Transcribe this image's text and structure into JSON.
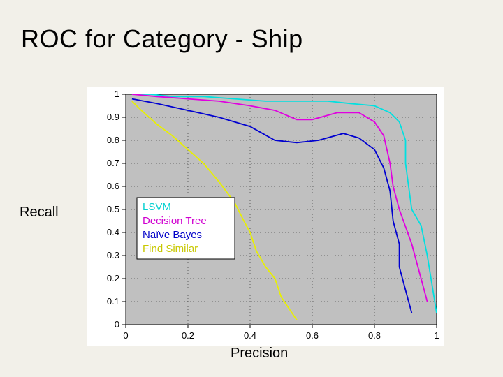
{
  "title": "ROC for Category - Ship",
  "ylabel": "Recall",
  "xlabel": "Precision",
  "legend": {
    "items": [
      "LSVM",
      "Decision Tree",
      "Naïve Bayes",
      "Find Similar"
    ]
  },
  "axes": {
    "x": {
      "min": 0,
      "max": 1,
      "ticks": [
        0,
        0.2,
        0.4,
        0.6,
        0.8,
        1
      ]
    },
    "y": {
      "min": 0,
      "max": 1,
      "ticks": [
        0,
        0.1,
        0.2,
        0.3,
        0.4,
        0.5,
        0.6,
        0.7,
        0.8,
        0.9,
        1
      ]
    }
  },
  "chart_data": {
    "type": "line",
    "title": "ROC for Category - Ship",
    "xlabel": "Precision",
    "ylabel": "Recall",
    "xlim": [
      0,
      1
    ],
    "ylim": [
      0,
      1
    ],
    "grid": true,
    "legend_position": "inside-left",
    "series": [
      {
        "name": "LSVM",
        "color": "#00e0e0",
        "x": [
          0.02,
          0.08,
          0.15,
          0.25,
          0.35,
          0.45,
          0.55,
          0.65,
          0.72,
          0.8,
          0.85,
          0.88,
          0.9,
          0.9,
          0.91,
          0.92,
          0.95,
          0.97,
          1.0
        ],
        "y": [
          1.0,
          1.0,
          0.99,
          0.99,
          0.98,
          0.97,
          0.97,
          0.97,
          0.96,
          0.95,
          0.92,
          0.88,
          0.8,
          0.7,
          0.6,
          0.5,
          0.43,
          0.3,
          0.05
        ]
      },
      {
        "name": "Decision Tree",
        "color": "#e000e0",
        "x": [
          0.02,
          0.1,
          0.2,
          0.3,
          0.4,
          0.48,
          0.55,
          0.6,
          0.68,
          0.75,
          0.8,
          0.83,
          0.85,
          0.86,
          0.88,
          0.92,
          0.97
        ],
        "y": [
          1.0,
          0.99,
          0.98,
          0.97,
          0.95,
          0.93,
          0.89,
          0.89,
          0.92,
          0.92,
          0.88,
          0.82,
          0.7,
          0.6,
          0.5,
          0.35,
          0.1
        ]
      },
      {
        "name": "Naïve Bayes",
        "color": "#0000d0",
        "x": [
          0.02,
          0.1,
          0.2,
          0.3,
          0.4,
          0.48,
          0.55,
          0.62,
          0.7,
          0.75,
          0.8,
          0.83,
          0.85,
          0.86,
          0.88,
          0.88,
          0.92
        ],
        "y": [
          0.98,
          0.96,
          0.93,
          0.9,
          0.86,
          0.8,
          0.79,
          0.8,
          0.83,
          0.81,
          0.76,
          0.68,
          0.58,
          0.45,
          0.35,
          0.25,
          0.05
        ]
      },
      {
        "name": "Find Similar",
        "color": "#e8f000",
        "x": [
          0.02,
          0.05,
          0.1,
          0.15,
          0.2,
          0.25,
          0.3,
          0.35,
          0.38,
          0.4,
          0.42,
          0.45,
          0.48,
          0.5,
          0.52,
          0.55
        ],
        "y": [
          0.97,
          0.93,
          0.87,
          0.82,
          0.76,
          0.7,
          0.62,
          0.53,
          0.45,
          0.4,
          0.32,
          0.25,
          0.2,
          0.12,
          0.08,
          0.02
        ]
      }
    ]
  }
}
